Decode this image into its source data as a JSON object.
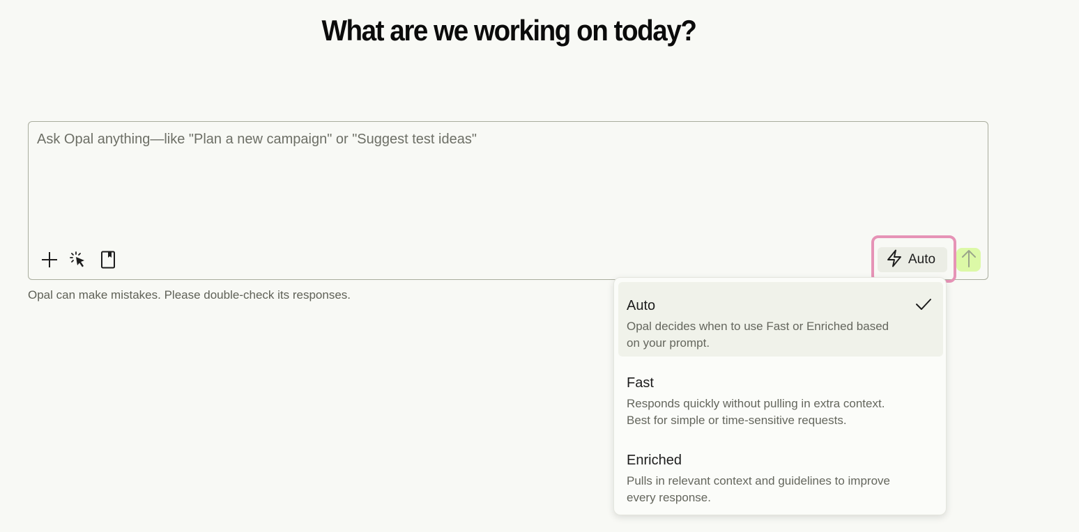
{
  "heading": "What are we working on today?",
  "composer": {
    "placeholder": "Ask Opal anything—like \"Plan a new campaign\" or \"Suggest test ideas\"",
    "value": "",
    "tools": [
      {
        "icon": "plus-icon"
      },
      {
        "icon": "sparkle-cursor-icon"
      },
      {
        "icon": "bookmark-icon"
      }
    ],
    "mode_button": {
      "icon": "lightning-icon",
      "label": "Auto"
    },
    "send_button": {
      "icon": "arrow-up-icon"
    }
  },
  "disclaimer": "Opal can make mistakes. Please double-check its responses.",
  "mode_menu": {
    "selected": "Auto",
    "options": [
      {
        "title": "Auto",
        "description": "Opal decides when to use Fast or Enriched based on your prompt.",
        "selected": true
      },
      {
        "title": "Fast",
        "description": "Responds quickly without pulling in extra context. Best for simple or time-sensitive requests.",
        "selected": false
      },
      {
        "title": "Enriched",
        "description": "Pulls in relevant context and guidelines to improve every response.",
        "selected": false
      }
    ]
  },
  "colors": {
    "background": "#f8f9f5",
    "send_button": "#dcf9a7",
    "highlight": "#e693b6",
    "selected_option": "#f0f2ea"
  }
}
